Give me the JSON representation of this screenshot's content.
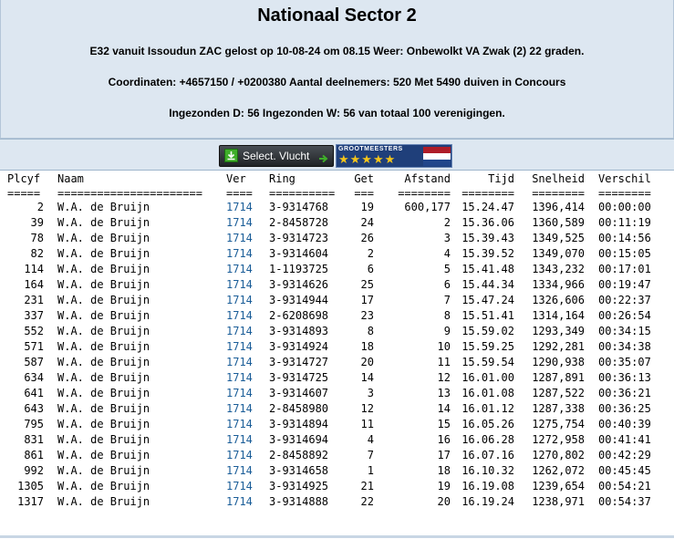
{
  "header": {
    "title": "Nationaal Sector 2",
    "line1": "E32 vanuit Issoudun ZAC gelost op 10-08-24 om 08.15 Weer: Onbewolkt VA Zwak (2) 22 graden.",
    "line2": "Coordinaten: +4657150 / +0200380 Aantal deelnemers: 520 Met 5490 duiven in Concours",
    "line3": "Ingezonden D: 56 Ingezonden W: 56 van totaal 100 verenigingen."
  },
  "toolbar": {
    "select_label": "Select. Vlucht",
    "banner_text": "GROOTMEESTERS",
    "banner_stars": "★★★★★"
  },
  "table": {
    "headers": {
      "plcyf": "Plcyf",
      "naam": "Naam",
      "ver": "Ver",
      "ring": "Ring",
      "get": "Get",
      "afstand": "Afstand",
      "tijd": "Tijd",
      "snelheid": "Snelheid",
      "verschil": "Verschil"
    },
    "separators": {
      "plcyf": "=====",
      "naam": "======================",
      "ver": "====",
      "ring": "==========",
      "get": "===",
      "afstand": "========",
      "tijd": "========",
      "snelheid": "========",
      "verschil": "========"
    },
    "rows": [
      {
        "plcyf": "2",
        "naam": "W.A. de Bruijn",
        "ver": "1714",
        "ring": "3-9314768",
        "get": "19",
        "afstand": "600,177",
        "tijd": "15.24.47",
        "snelheid": "1396,414",
        "verschil": "00:00:00"
      },
      {
        "plcyf": "39",
        "naam": "W.A. de Bruijn",
        "ver": "1714",
        "ring": "2-8458728",
        "get": "24",
        "afstand": "2",
        "tijd": "15.36.06",
        "snelheid": "1360,589",
        "verschil": "00:11:19"
      },
      {
        "plcyf": "78",
        "naam": "W.A. de Bruijn",
        "ver": "1714",
        "ring": "3-9314723",
        "get": "26",
        "afstand": "3",
        "tijd": "15.39.43",
        "snelheid": "1349,525",
        "verschil": "00:14:56"
      },
      {
        "plcyf": "82",
        "naam": "W.A. de Bruijn",
        "ver": "1714",
        "ring": "3-9314604",
        "get": "2",
        "afstand": "4",
        "tijd": "15.39.52",
        "snelheid": "1349,070",
        "verschil": "00:15:05"
      },
      {
        "plcyf": "114",
        "naam": "W.A. de Bruijn",
        "ver": "1714",
        "ring": "1-1193725",
        "get": "6",
        "afstand": "5",
        "tijd": "15.41.48",
        "snelheid": "1343,232",
        "verschil": "00:17:01"
      },
      {
        "plcyf": "164",
        "naam": "W.A. de Bruijn",
        "ver": "1714",
        "ring": "3-9314626",
        "get": "25",
        "afstand": "6",
        "tijd": "15.44.34",
        "snelheid": "1334,966",
        "verschil": "00:19:47"
      },
      {
        "plcyf": "231",
        "naam": "W.A. de Bruijn",
        "ver": "1714",
        "ring": "3-9314944",
        "get": "17",
        "afstand": "7",
        "tijd": "15.47.24",
        "snelheid": "1326,606",
        "verschil": "00:22:37"
      },
      {
        "plcyf": "337",
        "naam": "W.A. de Bruijn",
        "ver": "1714",
        "ring": "2-6208698",
        "get": "23",
        "afstand": "8",
        "tijd": "15.51.41",
        "snelheid": "1314,164",
        "verschil": "00:26:54"
      },
      {
        "plcyf": "552",
        "naam": "W.A. de Bruijn",
        "ver": "1714",
        "ring": "3-9314893",
        "get": "8",
        "afstand": "9",
        "tijd": "15.59.02",
        "snelheid": "1293,349",
        "verschil": "00:34:15"
      },
      {
        "plcyf": "571",
        "naam": "W.A. de Bruijn",
        "ver": "1714",
        "ring": "3-9314924",
        "get": "18",
        "afstand": "10",
        "tijd": "15.59.25",
        "snelheid": "1292,281",
        "verschil": "00:34:38"
      },
      {
        "plcyf": "587",
        "naam": "W.A. de Bruijn",
        "ver": "1714",
        "ring": "3-9314727",
        "get": "20",
        "afstand": "11",
        "tijd": "15.59.54",
        "snelheid": "1290,938",
        "verschil": "00:35:07"
      },
      {
        "plcyf": "634",
        "naam": "W.A. de Bruijn",
        "ver": "1714",
        "ring": "3-9314725",
        "get": "14",
        "afstand": "12",
        "tijd": "16.01.00",
        "snelheid": "1287,891",
        "verschil": "00:36:13"
      },
      {
        "plcyf": "641",
        "naam": "W.A. de Bruijn",
        "ver": "1714",
        "ring": "3-9314607",
        "get": "3",
        "afstand": "13",
        "tijd": "16.01.08",
        "snelheid": "1287,522",
        "verschil": "00:36:21"
      },
      {
        "plcyf": "643",
        "naam": "W.A. de Bruijn",
        "ver": "1714",
        "ring": "2-8458980",
        "get": "12",
        "afstand": "14",
        "tijd": "16.01.12",
        "snelheid": "1287,338",
        "verschil": "00:36:25"
      },
      {
        "plcyf": "795",
        "naam": "W.A. de Bruijn",
        "ver": "1714",
        "ring": "3-9314894",
        "get": "11",
        "afstand": "15",
        "tijd": "16.05.26",
        "snelheid": "1275,754",
        "verschil": "00:40:39"
      },
      {
        "plcyf": "831",
        "naam": "W.A. de Bruijn",
        "ver": "1714",
        "ring": "3-9314694",
        "get": "4",
        "afstand": "16",
        "tijd": "16.06.28",
        "snelheid": "1272,958",
        "verschil": "00:41:41"
      },
      {
        "plcyf": "861",
        "naam": "W.A. de Bruijn",
        "ver": "1714",
        "ring": "2-8458892",
        "get": "7",
        "afstand": "17",
        "tijd": "16.07.16",
        "snelheid": "1270,802",
        "verschil": "00:42:29"
      },
      {
        "plcyf": "992",
        "naam": "W.A. de Bruijn",
        "ver": "1714",
        "ring": "3-9314658",
        "get": "1",
        "afstand": "18",
        "tijd": "16.10.32",
        "snelheid": "1262,072",
        "verschil": "00:45:45"
      },
      {
        "plcyf": "1305",
        "naam": "W.A. de Bruijn",
        "ver": "1714",
        "ring": "3-9314925",
        "get": "21",
        "afstand": "19",
        "tijd": "16.19.08",
        "snelheid": "1239,654",
        "verschil": "00:54:21"
      },
      {
        "plcyf": "1317",
        "naam": "W.A. de Bruijn",
        "ver": "1714",
        "ring": "3-9314888",
        "get": "22",
        "afstand": "20",
        "tijd": "16.19.24",
        "snelheid": "1238,971",
        "verschil": "00:54:37"
      }
    ]
  },
  "colors": {
    "header_bg": "#dde7f1",
    "link": "#1a5d98",
    "flag_red": "#ae1c28",
    "flag_white": "#ffffff",
    "flag_blue": "#21468b"
  }
}
